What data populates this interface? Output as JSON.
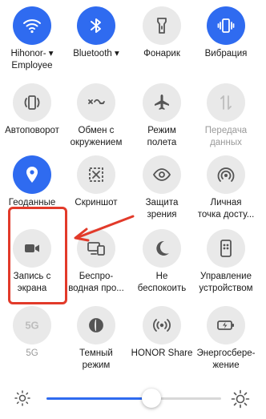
{
  "tiles": [
    {
      "label": "Hihonor-\nEmployee",
      "icon": "wifi-icon",
      "state": "on",
      "dropdown": true
    },
    {
      "label": "Bluetooth",
      "icon": "bluetooth-icon",
      "state": "on",
      "dropdown": true
    },
    {
      "label": "Фонарик",
      "icon": "flashlight-icon",
      "state": "off"
    },
    {
      "label": "Вибрация",
      "icon": "vibration-icon",
      "state": "on"
    },
    {
      "label": "Автоповорот",
      "icon": "auto-rotate-icon",
      "state": "off"
    },
    {
      "label": "Обмен с\nокружением",
      "icon": "share-nearby-icon",
      "state": "off"
    },
    {
      "label": "Режим\nполета",
      "icon": "airplane-icon",
      "state": "off"
    },
    {
      "label": "Передача\nданных",
      "icon": "mobile-data-icon",
      "state": "disabled"
    },
    {
      "label": "Геоданные",
      "icon": "location-icon",
      "state": "on"
    },
    {
      "label": "Скриншот",
      "icon": "screenshot-icon",
      "state": "off"
    },
    {
      "label": "Защита\nзрения",
      "icon": "eye-comfort-icon",
      "state": "off"
    },
    {
      "label": "Личная\nточка досту...",
      "icon": "hotspot-icon",
      "state": "off"
    },
    {
      "label": "Запись с\nэкрана",
      "icon": "screen-record-icon",
      "state": "off"
    },
    {
      "label": "Беспро-\nводная про...",
      "icon": "wireless-projection-icon",
      "state": "off"
    },
    {
      "label": "Не\nбеспокоить",
      "icon": "do-not-disturb-icon",
      "state": "off"
    },
    {
      "label": "Управление\nустройством",
      "icon": "device-control-icon",
      "state": "off"
    },
    {
      "label": "5G",
      "icon": "5g-icon",
      "state": "disabled"
    },
    {
      "label": "Темный\nрежим",
      "icon": "dark-mode-icon",
      "state": "off"
    },
    {
      "label": "HONOR Share",
      "icon": "honor-share-icon",
      "state": "off"
    },
    {
      "label": "Энергосбере-\nжение",
      "icon": "power-saving-icon",
      "state": "off"
    }
  ],
  "brightness": {
    "level": 0.6
  },
  "colors": {
    "accent": "#2f6bf0",
    "highlight": "#e23a2a",
    "tile_off": "#e9e9e9",
    "icon_off": "#555555"
  }
}
